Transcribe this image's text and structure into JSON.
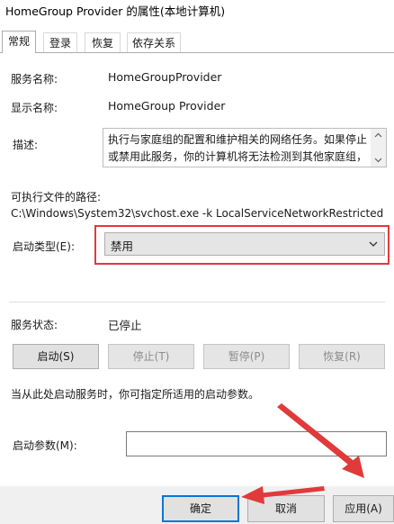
{
  "window": {
    "title": "HomeGroup Provider 的属性(本地计算机)"
  },
  "tabs": [
    {
      "label": "常规",
      "active": true
    },
    {
      "label": "登录",
      "active": false
    },
    {
      "label": "恢复",
      "active": false
    },
    {
      "label": "依存关系",
      "active": false
    }
  ],
  "general": {
    "service_name_label": "服务名称:",
    "service_name": "HomeGroupProvider",
    "display_name_label": "显示名称:",
    "display_name": "HomeGroup Provider",
    "description_label": "描述:",
    "description": "执行与家庭组的配置和维护相关的网络任务。如果停止或禁用此服务，你的计算机将无法检测到其他家庭组，",
    "exe_path_label": "可执行文件的路径:",
    "exe_path": "C:\\Windows\\System32\\svchost.exe -k LocalServiceNetworkRestricted",
    "startup_type_label": "启动类型(E):",
    "startup_type": "禁用",
    "service_status_label": "服务状态:",
    "service_status": "已停止",
    "buttons": {
      "start": "启动(S)",
      "stop": "停止(T)",
      "pause": "暂停(P)",
      "resume": "恢复(R)"
    },
    "hint": "当从此处启动服务时，你可指定所适用的启动参数。",
    "start_params_label": "启动参数(M):",
    "start_params_value": ""
  },
  "footer": {
    "ok": "确定",
    "cancel": "取消",
    "apply": "应用(A)"
  },
  "colors": {
    "annotation_red": "#e03a3a",
    "focus_blue": "#0078d7",
    "footer_bg": "#f0f0f0"
  }
}
